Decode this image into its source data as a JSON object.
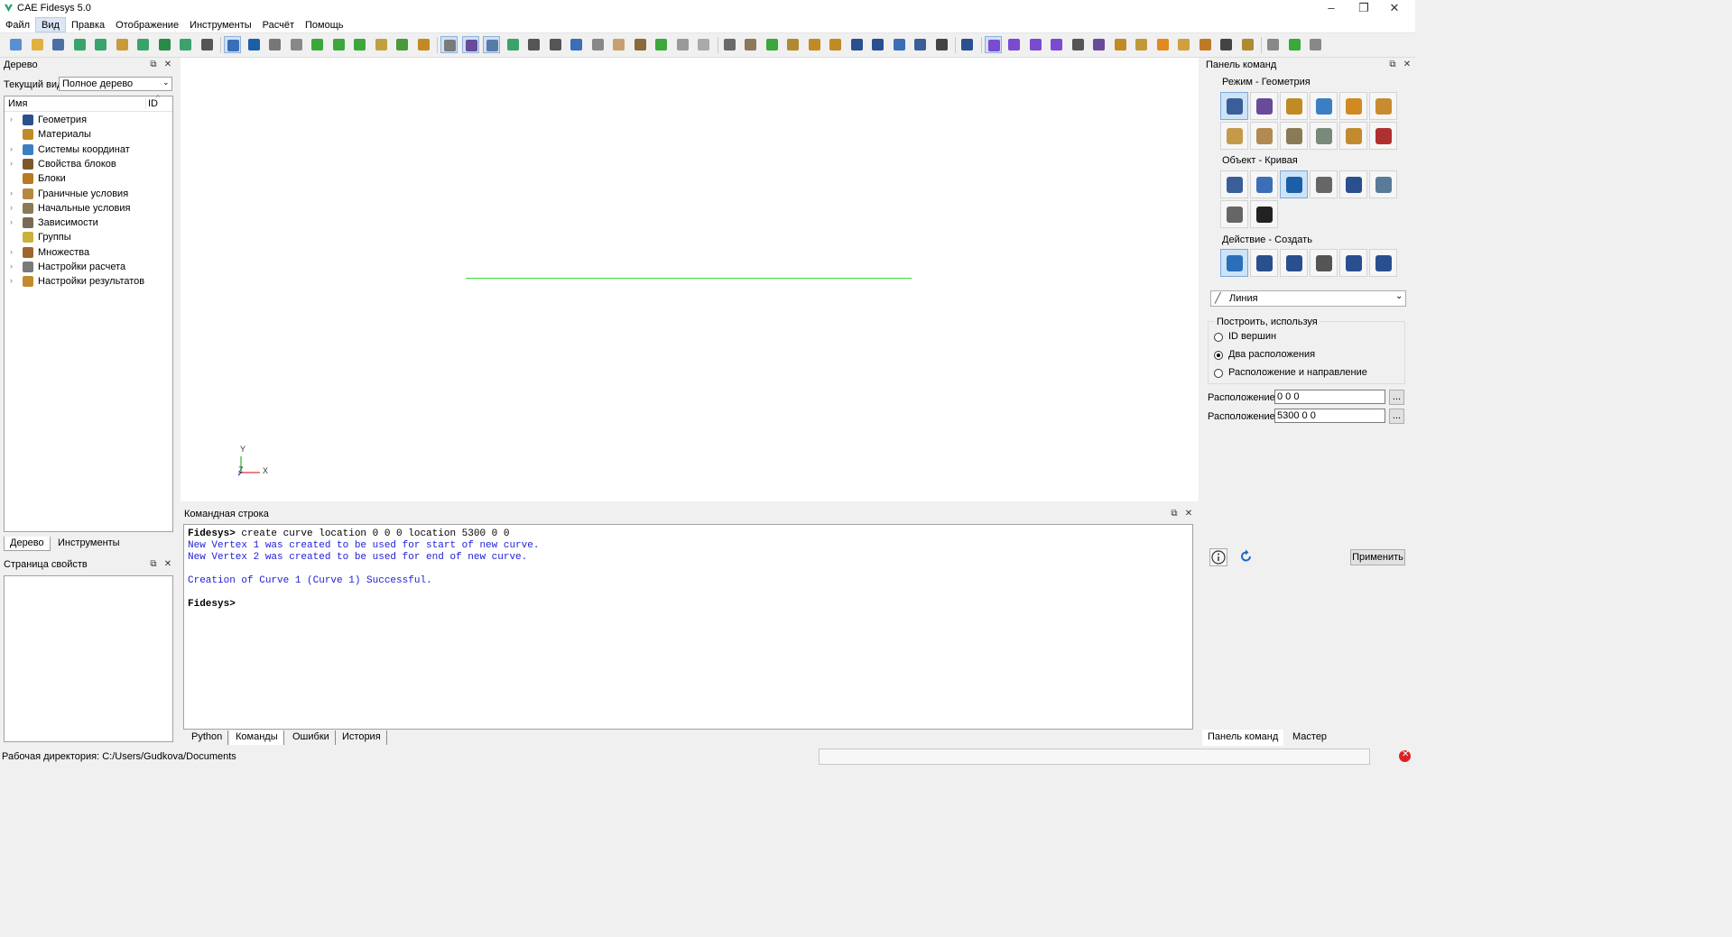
{
  "window": {
    "title": "CAE Fidesys 5.0"
  },
  "menu": [
    "Файл",
    "Вид",
    "Правка",
    "Отображение",
    "Инструменты",
    "Расчёт",
    "Помощь"
  ],
  "menu_active_index": 1,
  "tree_panel": {
    "title": "Дерево",
    "current_view_label": "Текущий вид",
    "current_view_value": "Полное дерево",
    "col_name": "Имя",
    "col_id": "ID",
    "items": [
      {
        "label": "Геометрия",
        "icon": "geometry-icon",
        "expandable": true
      },
      {
        "label": "Материалы",
        "icon": "materials-icon",
        "expandable": false
      },
      {
        "label": "Системы координат",
        "icon": "coordinate-systems-icon",
        "expandable": true
      },
      {
        "label": "Свойства блоков",
        "icon": "block-properties-icon",
        "expandable": true
      },
      {
        "label": "Блоки",
        "icon": "blocks-icon",
        "expandable": false
      },
      {
        "label": "Граничные условия",
        "icon": "boundary-conditions-icon",
        "expandable": true
      },
      {
        "label": "Начальные условия",
        "icon": "initial-conditions-icon",
        "expandable": true
      },
      {
        "label": "Зависимости",
        "icon": "dependencies-icon",
        "expandable": true
      },
      {
        "label": "Группы",
        "icon": "groups-icon",
        "expandable": false
      },
      {
        "label": "Множества",
        "icon": "sets-icon",
        "expandable": true
      },
      {
        "label": "Настройки расчета",
        "icon": "calc-settings-icon",
        "expandable": true
      },
      {
        "label": "Настройки результатов",
        "icon": "result-settings-icon",
        "expandable": true
      }
    ],
    "tabs": [
      "Дерево",
      "Инструменты"
    ]
  },
  "properties_panel": {
    "title": "Страница свойств"
  },
  "viewport": {
    "axis_x": "X",
    "axis_y": "Y",
    "axis_z": "Z",
    "curve_color": "#33dd33"
  },
  "console": {
    "title": "Командная строка",
    "lines": [
      {
        "prompt": "Fidesys>",
        "text": " create curve location 0 0 0 location 5300 0 0",
        "style": "cmd"
      },
      {
        "prompt": "",
        "text": "New Vertex 1 was created to be used for start of new curve.",
        "style": "info"
      },
      {
        "prompt": "",
        "text": "New Vertex 2 was created to be used for end of new curve.",
        "style": "info"
      },
      {
        "prompt": "",
        "text": "",
        "style": "info"
      },
      {
        "prompt": "",
        "text": "Creation of Curve 1 (Curve 1) Successful.",
        "style": "info"
      },
      {
        "prompt": "",
        "text": "",
        "style": "info"
      },
      {
        "prompt": "Fidesys>",
        "text": "",
        "style": "cmd"
      }
    ],
    "tabs": [
      "Python",
      "Команды",
      "Ошибки",
      "История"
    ],
    "active_tab": 1
  },
  "command_panel": {
    "title": "Панель команд",
    "mode_label": "Режим - Геометрия",
    "object_label": "Объект - Кривая",
    "action_label": "Действие - Создать",
    "type_dropdown": "Линия",
    "build_using_label": "Построить, используя",
    "radio_options": [
      "ID вершин",
      "Два расположения",
      "Расположение и направление"
    ],
    "radio_selected": 1,
    "location1_label": "Расположение",
    "location1_value": "0 0 0",
    "location2_label": "Расположение",
    "location2_value": "5300 0 0",
    "browse_label": "...",
    "apply_label": "Применить",
    "tabs": [
      "Панель команд",
      "Мастер"
    ]
  },
  "statusbar": {
    "workdir": "Рабочая директория: C:/Users/Gudkova/Documents"
  }
}
